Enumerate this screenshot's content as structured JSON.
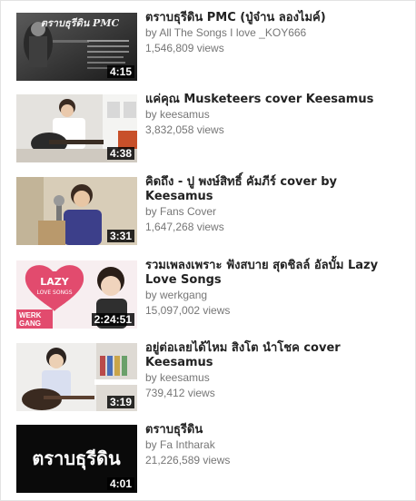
{
  "videos": [
    {
      "title": "ตราบธุรีดิน PMC (ปู่จ๋าน ลองไมค์)",
      "channel": "by All The Songs I love _KOY666",
      "views": "1,546,809 views",
      "duration": "4:15",
      "thumb_text": "ตราบธุรีดิน PMC"
    },
    {
      "title": "แค่คุณ Musketeers cover Keesamus",
      "channel": "by keesamus",
      "views": "3,832,058 views",
      "duration": "4:38"
    },
    {
      "title": "คิดถึง - ปู พงษ์สิทธิ์ คัมภีร์ cover by Keesamus",
      "channel": "by Fans Cover",
      "views": "1,647,268 views",
      "duration": "3:31"
    },
    {
      "title": "รวมเพลงเพราะ ฟังสบาย สุดชิลล์ อัลบั้ม Lazy Love Songs",
      "channel": "by werkgang",
      "views": "15,097,002 views",
      "duration": "2:24:51",
      "thumb_text_1": "LAZY",
      "thumb_text_2": "LOVE SONGS",
      "thumb_text_3": "WERK",
      "thumb_text_4": "GANG"
    },
    {
      "title": "อยู่ต่อเลยได้ไหม สิงโต นำโชค cover Keesamus",
      "channel": "by keesamus",
      "views": "739,412 views",
      "duration": "3:19"
    },
    {
      "title": "ตราบธุรีดิน",
      "channel": "by Fa Intharak",
      "views": "21,226,589 views",
      "duration": "4:01",
      "thumb_text": "ตราบธุรีดิน"
    }
  ],
  "colors": {
    "title": "#222222",
    "meta": "#767676",
    "duration_bg": "#000000"
  }
}
